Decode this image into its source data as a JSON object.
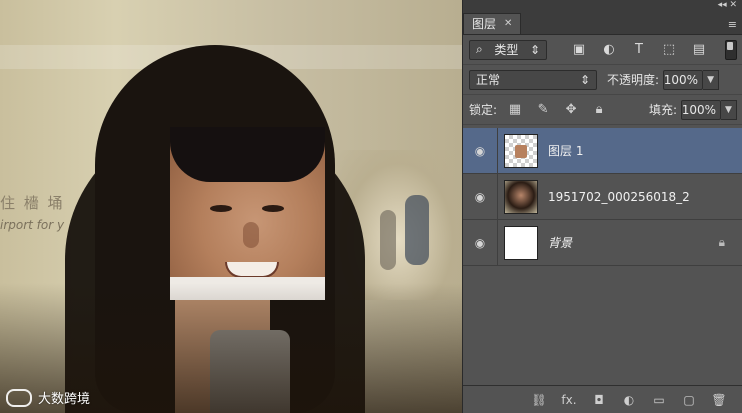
{
  "panel": {
    "tab_label": "图层",
    "filter": {
      "label": "类型",
      "icon": "search-icon"
    },
    "filter_icons": [
      "image-filter-icon",
      "adjustment-filter-icon",
      "text-filter-icon",
      "shape-filter-icon",
      "smart-object-filter-icon"
    ],
    "blend_mode": "正常",
    "opacity_label": "不透明度:",
    "opacity_value": "100%",
    "lock_label": "锁定:",
    "fill_label": "填充:",
    "fill_value": "100%",
    "layers": [
      {
        "name": "图层 1",
        "selected": true,
        "thumb": "face-transparent"
      },
      {
        "name": "1951702_000256018_2",
        "selected": false,
        "thumb": "photo"
      },
      {
        "name": "背景",
        "selected": false,
        "thumb": "white",
        "locked": true
      }
    ],
    "bottom_icons": [
      "link-icon",
      "fx-icon",
      "mask-icon",
      "adjustment-icon",
      "folder-icon",
      "new-layer-icon",
      "trash-icon"
    ],
    "fx_label": "fx."
  },
  "canvas": {
    "sign_text": "住 檣 埇",
    "sign_text_en": "irport for y",
    "watermark": "大数跨境"
  }
}
